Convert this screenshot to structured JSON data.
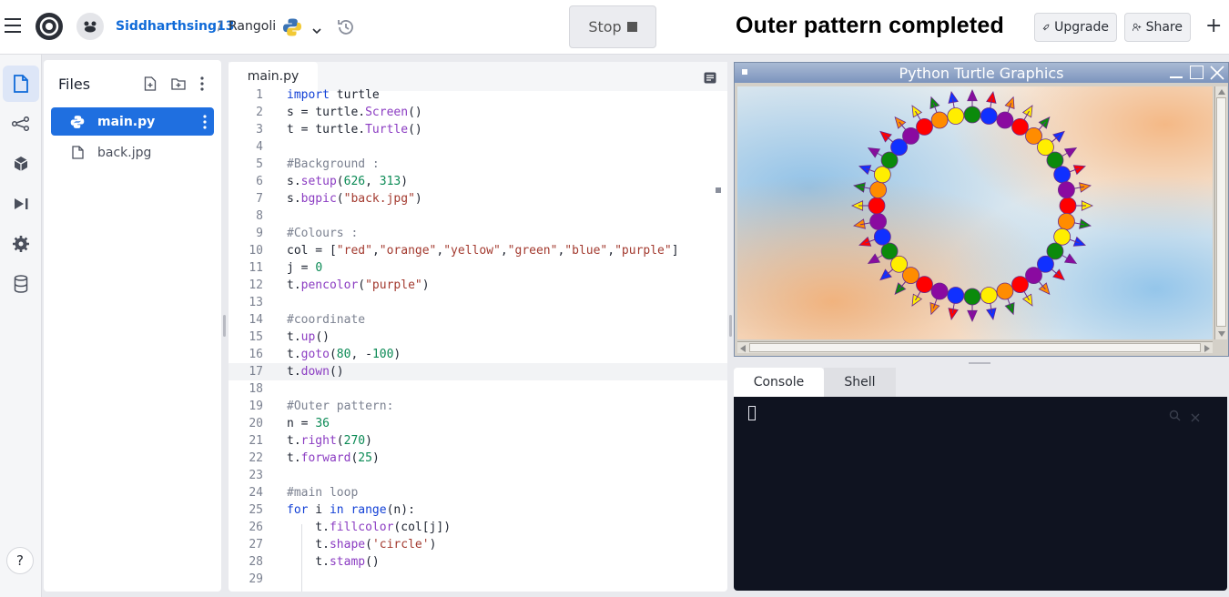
{
  "header": {
    "user": "Siddharthsing13",
    "separator": "/",
    "repl": "Rangoli",
    "stop_label": "Stop",
    "title": "Outer pattern completed",
    "upgrade_label": "Upgrade",
    "share_label": "Share",
    "plus": "+"
  },
  "files": {
    "title": "Files",
    "items": [
      {
        "name": "main.py",
        "active": true
      },
      {
        "name": "back.jpg",
        "active": false
      }
    ]
  },
  "editor": {
    "tab": "main.py",
    "lines": [
      {
        "n": "1",
        "t": "import turtle"
      },
      {
        "n": "2",
        "t": "s = turtle.Screen()"
      },
      {
        "n": "3",
        "t": "t = turtle.Turtle()"
      },
      {
        "n": "4",
        "t": ""
      },
      {
        "n": "5",
        "t": "#Background :"
      },
      {
        "n": "6",
        "t": "s.setup(626, 313)"
      },
      {
        "n": "7",
        "t": "s.bgpic(\"back.jpg\")"
      },
      {
        "n": "8",
        "t": ""
      },
      {
        "n": "9",
        "t": "#Colours :"
      },
      {
        "n": "10",
        "t": "col = [\"red\",\"orange\",\"yellow\",\"green\",\"blue\",\"purple\"]"
      },
      {
        "n": "11",
        "t": "j = 0"
      },
      {
        "n": "12",
        "t": "t.pencolor(\"purple\")"
      },
      {
        "n": "13",
        "t": ""
      },
      {
        "n": "14",
        "t": "#coordinate"
      },
      {
        "n": "15",
        "t": "t.up()"
      },
      {
        "n": "16",
        "t": "t.goto(80, -100)"
      },
      {
        "n": "17",
        "t": "t.down()"
      },
      {
        "n": "18",
        "t": ""
      },
      {
        "n": "19",
        "t": "#Outer pattern:"
      },
      {
        "n": "20",
        "t": "n = 36"
      },
      {
        "n": "21",
        "t": "t.right(270)"
      },
      {
        "n": "22",
        "t": "t.forward(25)"
      },
      {
        "n": "23",
        "t": ""
      },
      {
        "n": "24",
        "t": "#main loop"
      },
      {
        "n": "25",
        "t": "for i in range(n):"
      },
      {
        "n": "26",
        "t": "    t.fillcolor(col[j])"
      },
      {
        "n": "27",
        "t": "    t.shape('circle')"
      },
      {
        "n": "28",
        "t": "    t.stamp()"
      },
      {
        "n": "29",
        "t": ""
      }
    ]
  },
  "turtle_window": {
    "title": "Python Turtle Graphics",
    "dot_colors": [
      "#ff0000",
      "#ff8c00",
      "#ffee00",
      "#0b8a0b",
      "#1030ff",
      "#8a0aa0"
    ],
    "dot_count": 36
  },
  "console": {
    "tabs": [
      "Console",
      "Shell"
    ]
  },
  "help": "?"
}
